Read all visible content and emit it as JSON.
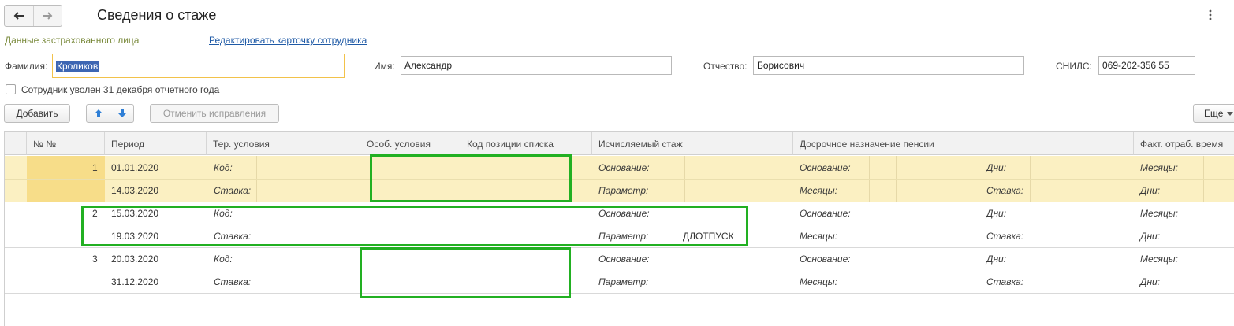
{
  "window": {
    "title": "Сведения о стаже",
    "nav_back": "arrow-left-icon",
    "nav_forward": "arrow-right-icon",
    "menu": "more-vertical-icon"
  },
  "section_label": "Данные застрахованного лица",
  "edit_link": "Редактировать карточку сотрудника",
  "fields": {
    "surname": {
      "label": "Фамилия:",
      "value": "Кроликов"
    },
    "name": {
      "label": "Имя:",
      "value": "Александр"
    },
    "patronymic": {
      "label": "Отчество:",
      "value": "Борисович"
    },
    "snils": {
      "label": "СНИЛС:",
      "value": "069-202-356 55"
    }
  },
  "dismissed_checkbox": {
    "label": "Сотрудник уволен 31 декабря отчетного года",
    "checked": false
  },
  "toolbar": {
    "add": "Добавить",
    "move_up": "arrow-up-icon",
    "move_down": "arrow-down-icon",
    "cancel_corrections": "Отменить исправления",
    "more": "Еще"
  },
  "table": {
    "columns": [
      "№ №",
      "Период",
      "Тер. условия",
      "Особ. условия",
      "Код позиции списка",
      "Исчисляемый стаж",
      "Досрочное назначение пенсии",
      "Факт. отраб. время"
    ],
    "rows": [
      {
        "num": "1",
        "start": "01.01.2020",
        "end": "14.03.2020",
        "ter_a": "Код:",
        "ter_b": "Ставка:",
        "stazh_a": "Основание:",
        "stazh_b": "Параметр:",
        "stazh_param": "",
        "early_a": "Основание:",
        "early_b": "Месяцы:",
        "early_c": "Дни:",
        "early_d": "Ставка:",
        "fact_a": "Месяцы:",
        "fact_b": "Дни:"
      },
      {
        "num": "2",
        "start": "15.03.2020",
        "end": "19.03.2020",
        "ter_a": "Код:",
        "ter_b": "Ставка:",
        "stazh_a": "Основание:",
        "stazh_b": "Параметр:",
        "stazh_param": "ДЛОТПУСК",
        "early_a": "Основание:",
        "early_b": "Месяцы:",
        "early_c": "Дни:",
        "early_d": "Ставка:",
        "fact_a": "Месяцы:",
        "fact_b": "Дни:"
      },
      {
        "num": "3",
        "start": "20.03.2020",
        "end": "31.12.2020",
        "ter_a": "Код:",
        "ter_b": "Ставка:",
        "stazh_a": "Основание:",
        "stazh_b": "Параметр:",
        "stazh_param": "",
        "early_a": "Основание:",
        "early_b": "Месяцы:",
        "early_c": "Дни:",
        "early_d": "Ставка:",
        "fact_a": "Месяцы:",
        "fact_b": "Дни:"
      }
    ]
  },
  "colors": {
    "selected_row": "#fbf0c2",
    "selected_num_cell": "#f7dd89",
    "highlight_box": "#22b022",
    "link": "#1f5aa6"
  }
}
